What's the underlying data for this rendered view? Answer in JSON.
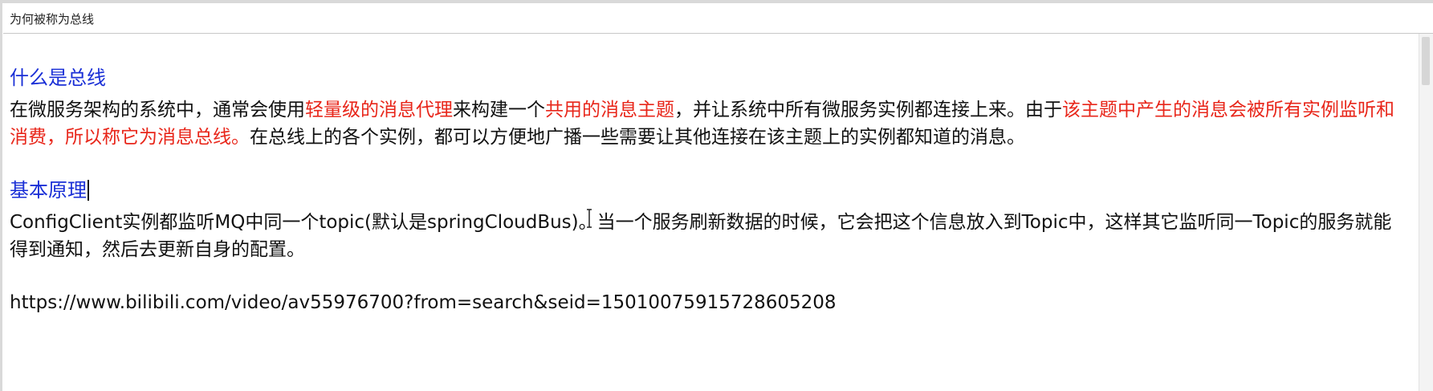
{
  "window": {
    "title": "为何被称为总线"
  },
  "doc": {
    "heading1": "什么是总线",
    "para1": {
      "s1": "在微服务架构的系统中，通常会使用",
      "s2": "轻量级的消息代理",
      "s3": "来构建一个",
      "s4": "共用的消息主题",
      "s5": "，并让系统中所有微服务实例都连接上来。由于",
      "s6": "该主题中产生的消息会被所有实例监听和消费，所以称它为消息总线。",
      "s7": "在总线上的各个实例，都可以方便地广播一些需要让其他连接在该主题上的实例都知道的消息。"
    },
    "heading2": "基本原理",
    "para2": "ConfigClient实例都监听MQ中同一个topic(默认是springCloudBus)。当一个服务刷新数据的时候，它会把这个信息放入到Topic中，这样其它监听同一Topic的服务就能得到通知，然后去更新自身的配置。",
    "url": "https://www.bilibili.com/video/av55976700?from=search&seid=15010075915728605208"
  },
  "colors": {
    "heading": "#1a2fd6",
    "highlight": "#e8261a",
    "text": "#111111"
  },
  "icons": {
    "cursor": "text-cursor-icon",
    "scroll": "scrollbar"
  }
}
